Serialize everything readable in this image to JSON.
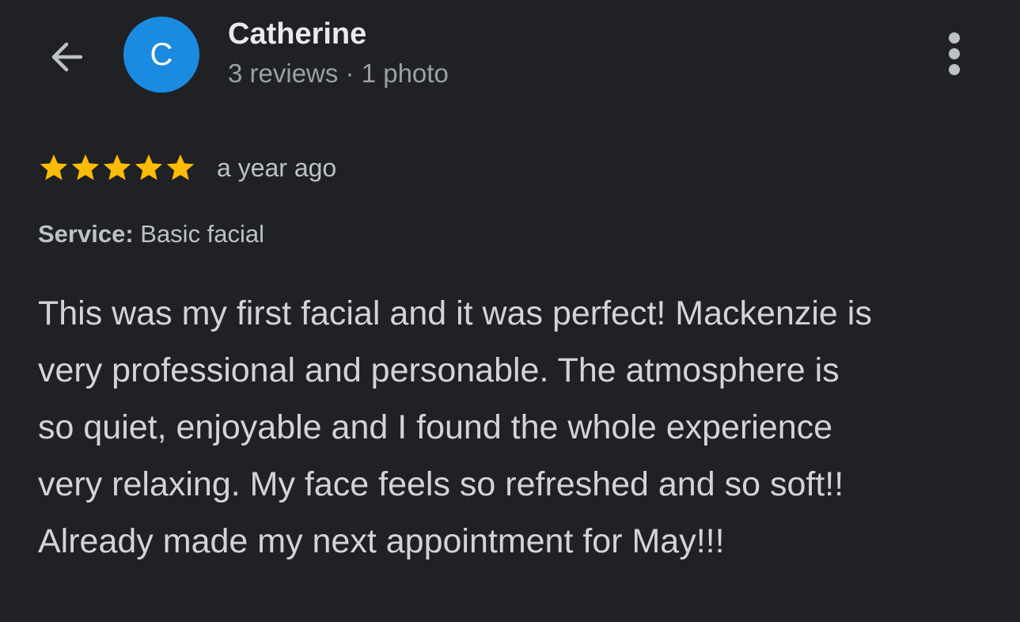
{
  "colors": {
    "background": "#202124",
    "avatar_bg": "#1a8be0",
    "star": "#fbbc04",
    "icon": "#bdc1c6"
  },
  "header": {
    "back_icon": "arrow-left",
    "avatar_initial": "C",
    "reviewer_name": "Catherine",
    "reviewer_stats": "3 reviews · 1 photo",
    "menu_icon": "more-vertical"
  },
  "review": {
    "rating": 5,
    "max_rating": 5,
    "time_ago": "a year ago",
    "service_label": "Service:",
    "service_value": "Basic facial",
    "text_lines": [
      "This was my first facial and it was perfect! Mackenzie is",
      "very professional and personable. The atmosphere is",
      "so quiet, enjoyable and I found the whole experience",
      "very relaxing. My face feels so refreshed and so soft!!",
      "Already made my next appointment for May!!!"
    ]
  }
}
